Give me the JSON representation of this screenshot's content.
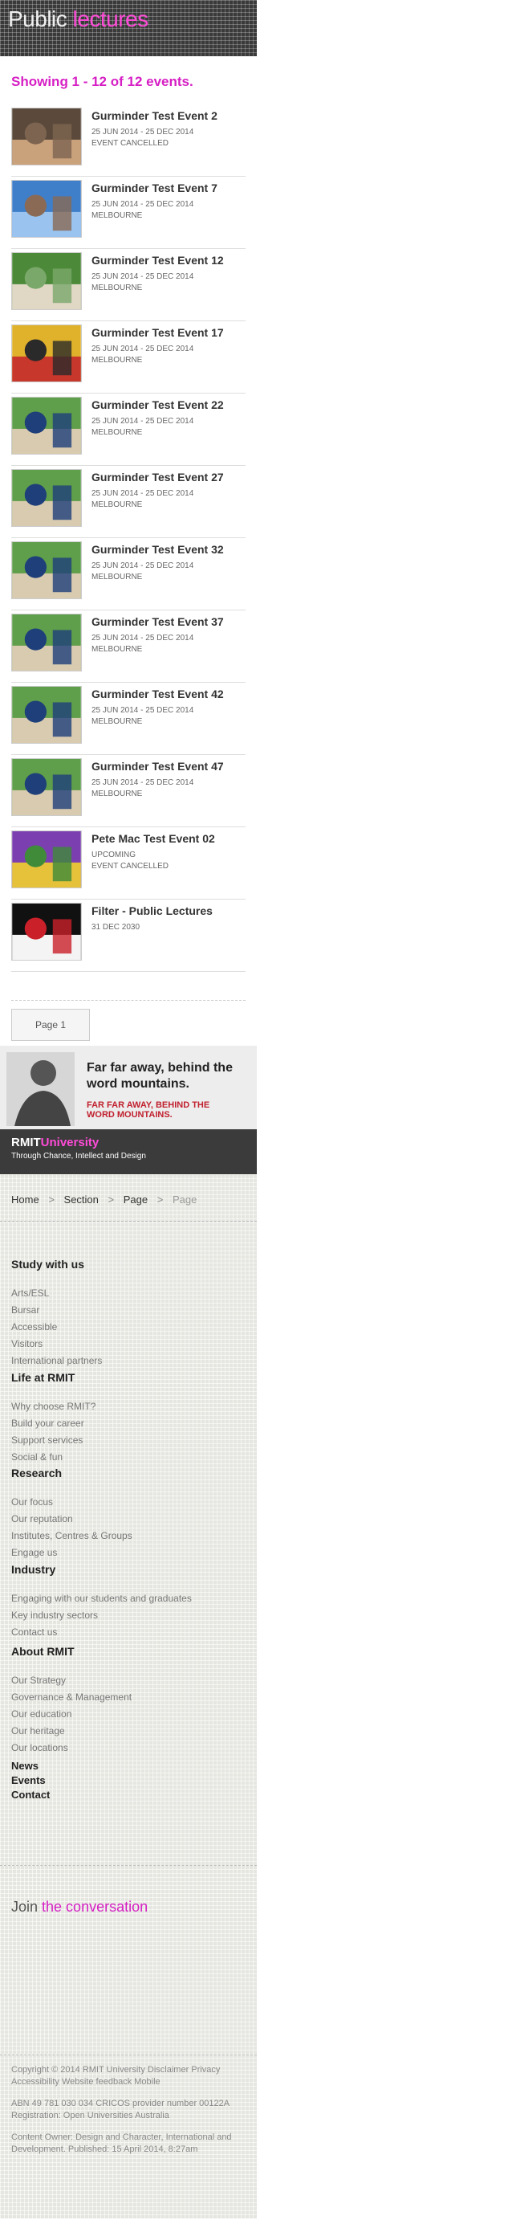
{
  "header": {
    "title_plain": "Public ",
    "title_accent": "lectures"
  },
  "results": {
    "showing": "Showing 1 - 12 of 12 events."
  },
  "events": [
    {
      "title": "Gurminder Test Event 2",
      "date": "25 JUN 2014 - 25 DEC 2014",
      "sub": "EVENT CANCELLED",
      "thumb": "portrait"
    },
    {
      "title": "Gurminder Test Event 7",
      "date": "25 JUN 2014 - 25 DEC 2014",
      "sub": "MELBOURNE",
      "thumb": "building"
    },
    {
      "title": "Gurminder Test Event 12",
      "date": "25 JUN 2014 - 25 DEC 2014",
      "sub": "MELBOURNE",
      "thumb": "crowd"
    },
    {
      "title": "Gurminder Test Event 17",
      "date": "25 JUN 2014 - 25 DEC 2014",
      "sub": "MELBOURNE",
      "thumb": "art"
    },
    {
      "title": "Gurminder Test Event 22",
      "date": "25 JUN 2014 - 25 DEC 2014",
      "sub": "MELBOURNE",
      "thumb": "people"
    },
    {
      "title": "Gurminder Test Event 27",
      "date": "25 JUN 2014 - 25 DEC 2014",
      "sub": "MELBOURNE",
      "thumb": "people"
    },
    {
      "title": "Gurminder Test Event 32",
      "date": "25 JUN 2014 - 25 DEC 2014",
      "sub": "MELBOURNE",
      "thumb": "people"
    },
    {
      "title": "Gurminder Test Event 37",
      "date": "25 JUN 2014 - 25 DEC 2014",
      "sub": "MELBOURNE",
      "thumb": "people"
    },
    {
      "title": "Gurminder Test Event 42",
      "date": "25 JUN 2014 - 25 DEC 2014",
      "sub": "MELBOURNE",
      "thumb": "people"
    },
    {
      "title": "Gurminder Test Event 47",
      "date": "25 JUN 2014 - 25 DEC 2014",
      "sub": "MELBOURNE",
      "thumb": "people"
    },
    {
      "title": "Pete Mac Test Event 02",
      "date": "UPCOMING",
      "sub": "EVENT CANCELLED",
      "thumb": "flower"
    },
    {
      "title": "Filter - Public Lectures",
      "date": "31 DEC 2030",
      "sub": "",
      "thumb": "graffiti"
    }
  ],
  "pager": {
    "label": "Page 1"
  },
  "banner": {
    "line1": "Far far away, behind the word mountains.",
    "line2": "FAR FAR AWAY, BEHIND THE WORD MOUNTAINS.",
    "brand_white": "RMIT",
    "brand_accent": "University",
    "tagline": "Through Chance, Intellect and Design"
  },
  "breadcrumb": {
    "home": "Home",
    "section": "Section",
    "page": "Page",
    "current": "Page",
    "sep": ">"
  },
  "footer": {
    "study": {
      "title": "Study with us",
      "links": [
        "Arts/ESL",
        "Bursar",
        "Accessible",
        "Visitors",
        "International partners"
      ]
    },
    "life": {
      "title": "Life at RMIT",
      "links": [
        "Why choose RMIT?",
        "Build your career",
        "Support services",
        "Social & fun"
      ]
    },
    "research": {
      "title": "Research",
      "links": [
        "Our focus",
        "Our reputation",
        "Institutes, Centres & Groups",
        "Engage us"
      ]
    },
    "industry": {
      "title": "Industry",
      "links": [
        "Engaging with our students and graduates",
        "Key industry sectors",
        "Contact us"
      ]
    },
    "about": {
      "title": "About RMIT",
      "links": [
        "Our Strategy",
        "Governance & Management",
        "Our education",
        "Our heritage",
        "Our locations"
      ]
    },
    "plain": [
      "News",
      "Events",
      "Contact"
    ],
    "join_plain": "Join ",
    "join_accent": "the conversation",
    "copyright": "Copyright © 2014 RMIT University Disclaimer Privacy Accessibility Website feedback Mobile",
    "abn": "ABN 49 781 030 034 CRICOS provider number 00122A Registration: Open Universities Australia",
    "owner": "Content Owner: Design and Character, International and Development. Published: 15 April 2014, 8:27am"
  },
  "colors": {
    "accent": "#d61fc4",
    "dark": "#3a3a3a"
  }
}
